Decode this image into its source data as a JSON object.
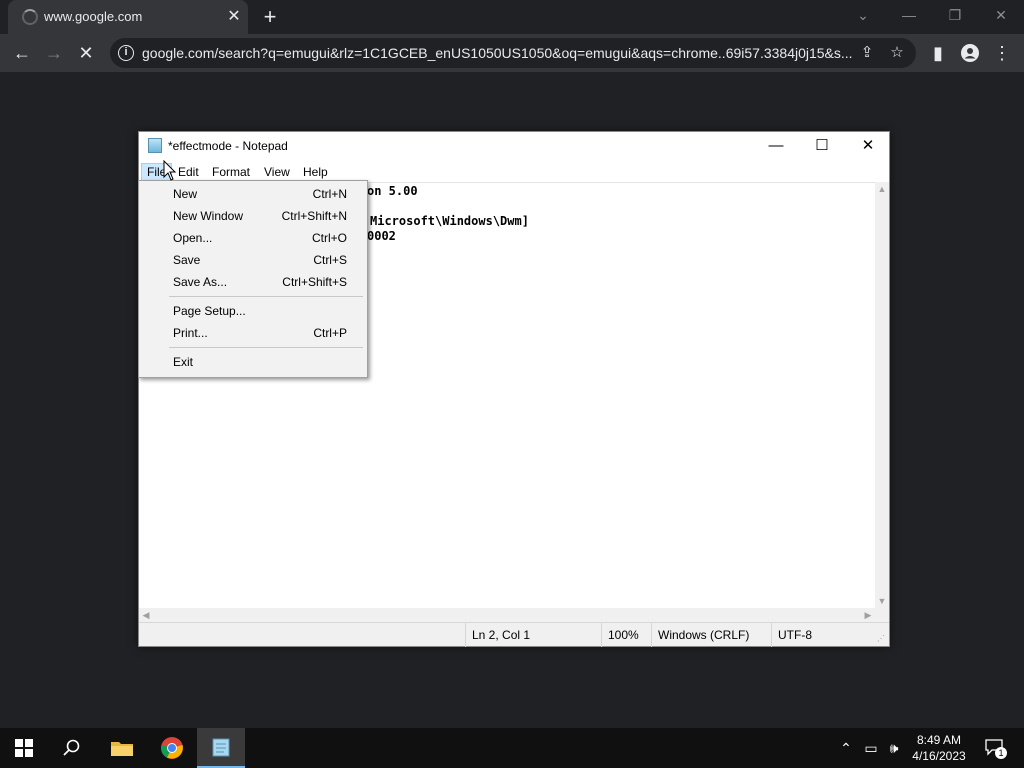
{
  "browser": {
    "tab_title": "www.google.com",
    "url": "google.com/search?q=emugui&rlz=1C1GCEB_enUS1050US1050&oq=emugui&aqs=chrome..69i57.3384j0j15&s...",
    "icons": [
      "back-icon",
      "forward-icon",
      "stop-icon",
      "info-icon",
      "share-icon",
      "star-icon",
      "side-panel-icon",
      "profile-icon",
      "kebab-menu-icon"
    ]
  },
  "notepad": {
    "title": "*effectmode - Notepad",
    "menu": [
      "File",
      "Edit",
      "Format",
      "View",
      "Help"
    ],
    "lines": [
      "on 5.00",
      "",
      "Microsoft\\Windows\\Dwm]",
      "0002"
    ],
    "status": {
      "position": "Ln 2, Col 1",
      "zoom": "100%",
      "line_ending": "Windows (CRLF)",
      "encoding": "UTF-8"
    }
  },
  "file_menu": {
    "items": [
      {
        "label": "New",
        "shortcut": "Ctrl+N"
      },
      {
        "label": "New Window",
        "shortcut": "Ctrl+Shift+N"
      },
      {
        "label": "Open...",
        "shortcut": "Ctrl+O"
      },
      {
        "label": "Save",
        "shortcut": "Ctrl+S"
      },
      {
        "label": "Save As...",
        "shortcut": "Ctrl+Shift+S"
      },
      {
        "label": "Page Setup...",
        "shortcut": ""
      },
      {
        "label": "Print...",
        "shortcut": "Ctrl+P"
      },
      {
        "label": "Exit",
        "shortcut": ""
      }
    ]
  },
  "taskbar": {
    "time": "8:49 AM",
    "date": "4/16/2023",
    "notification_count": "1"
  },
  "colors": {
    "chrome_dark": "#202124",
    "chrome_toolbar": "#35363a",
    "menu_highlight": "#cce8ff",
    "taskbar": "#101010"
  }
}
